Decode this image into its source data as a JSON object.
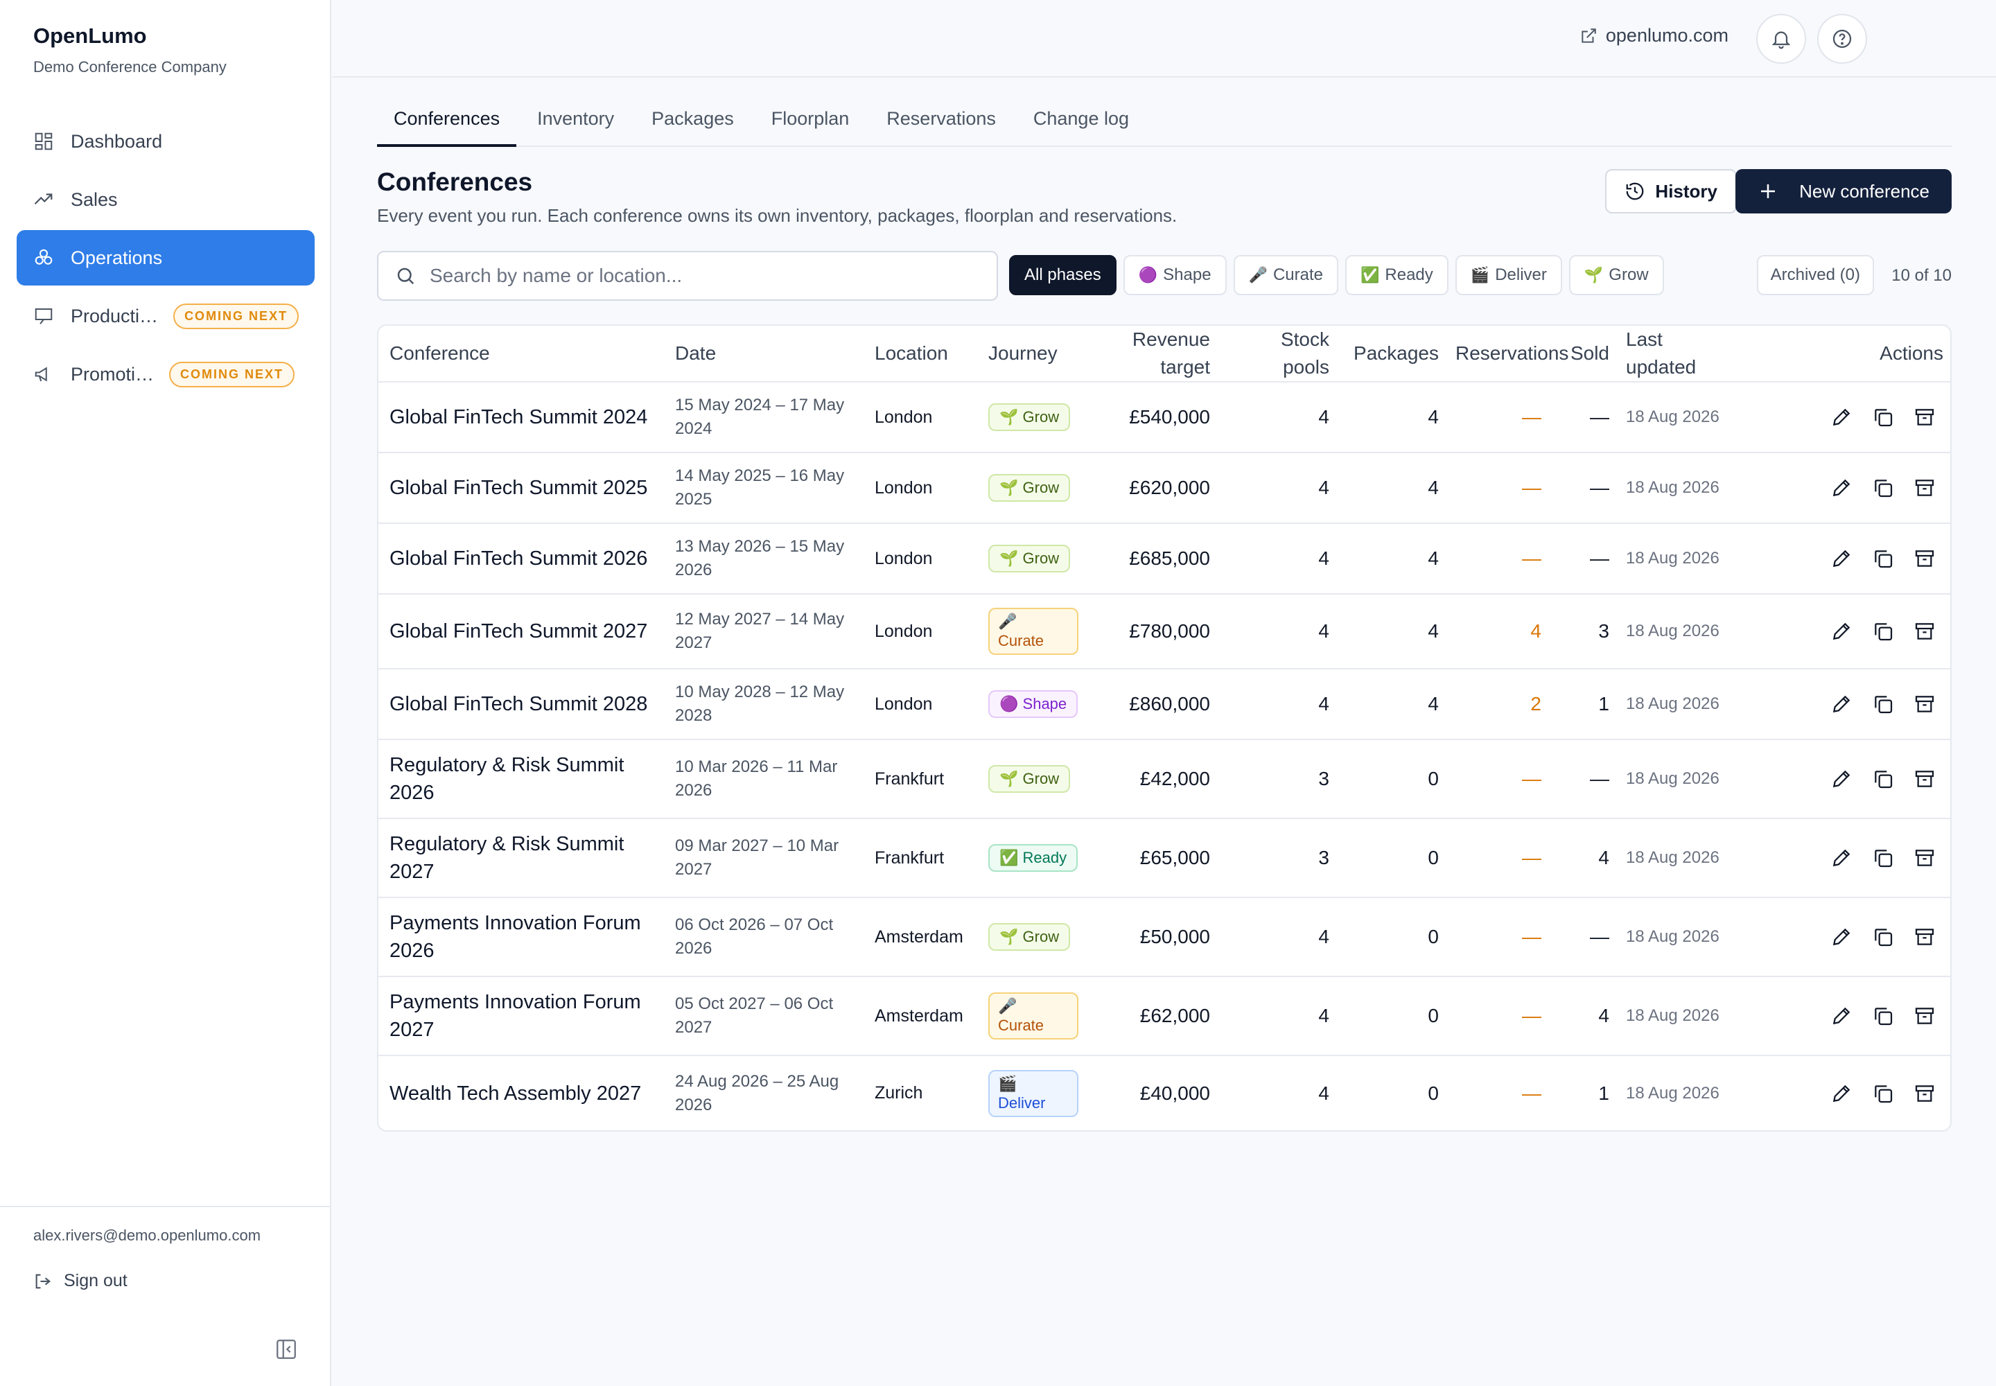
{
  "app": {
    "name": "OpenLumo",
    "company": "Demo Conference Company"
  },
  "sidebar": {
    "items": [
      {
        "label": "Dashboard",
        "icon": "dashboard-icon",
        "active": false
      },
      {
        "label": "Sales",
        "icon": "trending-up-icon",
        "active": false
      },
      {
        "label": "Operations",
        "icon": "operations-icon",
        "active": true
      },
      {
        "label": "Producti…",
        "icon": "presentation-icon",
        "active": false,
        "badge": "COMING NEXT"
      },
      {
        "label": "Promoti…",
        "icon": "megaphone-icon",
        "active": false,
        "badge": "COMING NEXT"
      }
    ],
    "user_email": "alex.rivers@demo.openlumo.com",
    "sign_out": "Sign out"
  },
  "topbar": {
    "site_link": "openlumo.com"
  },
  "tabs": [
    "Conferences",
    "Inventory",
    "Packages",
    "Floorplan",
    "Reservations",
    "Change log"
  ],
  "page": {
    "title": "Conferences",
    "description": "Every event you run. Each conference owns its own inventory, packages, floorplan and reservations.",
    "history_button": "History",
    "new_button": "New conference"
  },
  "filters": {
    "search_placeholder": "Search by name or location...",
    "chips": [
      {
        "label": "All phases",
        "emoji": "",
        "active": true
      },
      {
        "label": "Shape",
        "emoji": "🟣",
        "active": false
      },
      {
        "label": "Curate",
        "emoji": "🎤",
        "active": false
      },
      {
        "label": "Ready",
        "emoji": "✅",
        "active": false
      },
      {
        "label": "Deliver",
        "emoji": "🎬",
        "active": false
      },
      {
        "label": "Grow",
        "emoji": "🌱",
        "active": false
      }
    ],
    "archived": "Archived (0)",
    "count": "10 of 10"
  },
  "table": {
    "headers": {
      "conference": "Conference",
      "date": "Date",
      "location": "Location",
      "journey": "Journey",
      "revenue_1": "Revenue",
      "revenue_2": "target",
      "stock_1": "Stock",
      "stock_2": "pools",
      "packages": "Packages",
      "reservations": "Reservations",
      "sold": "Sold",
      "updated_1": "Last",
      "updated_2": "updated",
      "actions": "Actions"
    },
    "rows": [
      {
        "name": "Global FinTech Summit 2024",
        "date": "15 May 2024 – 17 May 2024",
        "location": "London",
        "phase": "Grow",
        "phase_emoji": "🌱",
        "revenue": "£540,000",
        "stock": "4",
        "packages": "4",
        "reservations": "—",
        "sold": "—",
        "updated": "18 Aug 2026"
      },
      {
        "name": "Global FinTech Summit 2025",
        "date": "14 May 2025 – 16 May 2025",
        "location": "London",
        "phase": "Grow",
        "phase_emoji": "🌱",
        "revenue": "£620,000",
        "stock": "4",
        "packages": "4",
        "reservations": "—",
        "sold": "—",
        "updated": "18 Aug 2026"
      },
      {
        "name": "Global FinTech Summit 2026",
        "date": "13 May 2026 – 15 May 2026",
        "location": "London",
        "phase": "Grow",
        "phase_emoji": "🌱",
        "revenue": "£685,000",
        "stock": "4",
        "packages": "4",
        "reservations": "—",
        "sold": "—",
        "updated": "18 Aug 2026"
      },
      {
        "name": "Global FinTech Summit 2027",
        "date": "12 May 2027 – 14 May 2027",
        "location": "London",
        "phase": "Curate",
        "phase_emoji": "🎤",
        "revenue": "£780,000",
        "stock": "4",
        "packages": "4",
        "reservations": "4",
        "sold": "3",
        "updated": "18 Aug 2026"
      },
      {
        "name": "Global FinTech Summit 2028",
        "date": "10 May 2028 – 12 May 2028",
        "location": "London",
        "phase": "Shape",
        "phase_emoji": "🟣",
        "revenue": "£860,000",
        "stock": "4",
        "packages": "4",
        "reservations": "2",
        "sold": "1",
        "updated": "18 Aug 2026"
      },
      {
        "name": "Regulatory & Risk Summit 2026",
        "date": "10 Mar 2026 – 11 Mar 2026",
        "location": "Frankfurt",
        "phase": "Grow",
        "phase_emoji": "🌱",
        "revenue": "£42,000",
        "stock": "3",
        "packages": "0",
        "reservations": "—",
        "sold": "—",
        "updated": "18 Aug 2026"
      },
      {
        "name": "Regulatory & Risk Summit 2027",
        "date": "09 Mar 2027 – 10 Mar 2027",
        "location": "Frankfurt",
        "phase": "Ready",
        "phase_emoji": "✅",
        "revenue": "£65,000",
        "stock": "3",
        "packages": "0",
        "reservations": "—",
        "sold": "4",
        "updated": "18 Aug 2026"
      },
      {
        "name": "Payments Innovation Forum 2026",
        "date": "06 Oct 2026 – 07 Oct 2026",
        "location": "Amsterdam",
        "phase": "Grow",
        "phase_emoji": "🌱",
        "revenue": "£50,000",
        "stock": "4",
        "packages": "0",
        "reservations": "—",
        "sold": "—",
        "updated": "18 Aug 2026"
      },
      {
        "name": "Payments Innovation Forum 2027",
        "date": "05 Oct 2027 – 06 Oct 2027",
        "location": "Amsterdam",
        "phase": "Curate",
        "phase_emoji": "🎤",
        "revenue": "£62,000",
        "stock": "4",
        "packages": "0",
        "reservations": "—",
        "sold": "4",
        "updated": "18 Aug 2026"
      },
      {
        "name": "Wealth Tech Assembly 2027",
        "date": "24 Aug 2026 – 25 Aug 2026",
        "location": "Zurich",
        "phase": "Deliver",
        "phase_emoji": "🎬",
        "revenue": "£40,000",
        "stock": "4",
        "packages": "0",
        "reservations": "—",
        "sold": "1",
        "updated": "18 Aug 2026"
      }
    ]
  },
  "colors": {
    "accent": "#2f7de8",
    "primary_button": "#14213d",
    "coming_next": "#e08a0b",
    "reservations": "#d97706"
  }
}
